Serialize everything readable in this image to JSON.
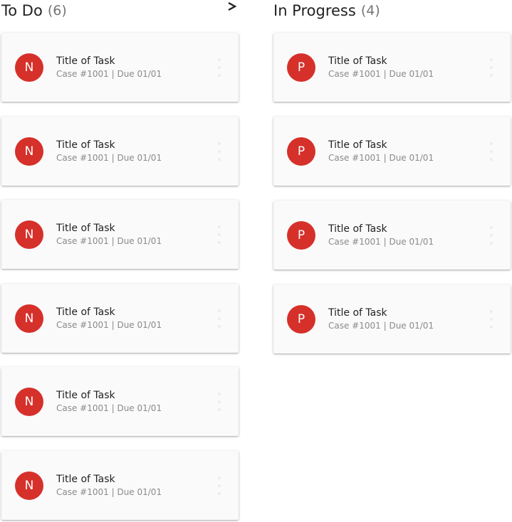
{
  "columns": [
    {
      "title": "To Do",
      "count": "(6)",
      "has_next_arrow": true,
      "cards": [
        {
          "initial": "N",
          "title": "Title of Task",
          "subtitle": "Case #1001 | Due 01/01"
        },
        {
          "initial": "N",
          "title": "Title of Task",
          "subtitle": "Case #1001 | Due 01/01"
        },
        {
          "initial": "N",
          "title": "Title of Task",
          "subtitle": "Case #1001 | Due 01/01"
        },
        {
          "initial": "N",
          "title": "Title of Task",
          "subtitle": "Case #1001 | Due 01/01"
        },
        {
          "initial": "N",
          "title": "Title of Task",
          "subtitle": "Case #1001 | Due 01/01"
        },
        {
          "initial": "N",
          "title": "Title of Task",
          "subtitle": "Case #1001 | Due 01/01"
        }
      ]
    },
    {
      "title": "In Progress",
      "count": "(4)",
      "has_next_arrow": false,
      "cards": [
        {
          "initial": "P",
          "title": "Title of Task",
          "subtitle": "Case #1001 | Due 01/01"
        },
        {
          "initial": "P",
          "title": "Title of Task",
          "subtitle": "Case #1001 | Due 01/01"
        },
        {
          "initial": "P",
          "title": "Title of Task",
          "subtitle": "Case #1001 | Due 01/01"
        },
        {
          "initial": "P",
          "title": "Title of Task",
          "subtitle": "Case #1001 | Due 01/01"
        }
      ]
    }
  ],
  "icons": {
    "next_column": "chevron-right-icon",
    "card_menu": "more-vertical-icon"
  },
  "colors": {
    "avatar": "#d6302a",
    "card_background": "#fafafa",
    "count_text": "#757575",
    "subtitle_text": "#8a8a8a"
  }
}
